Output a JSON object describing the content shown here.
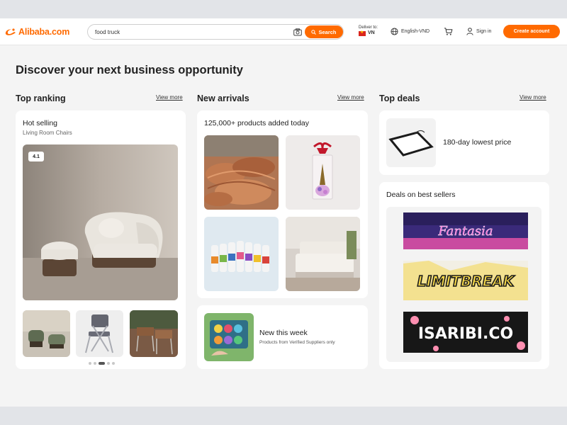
{
  "header": {
    "logo_text": "Alibaba.com",
    "search_value": "food truck",
    "search_button": "Search",
    "deliver_label": "Deliver to:",
    "deliver_country": "VN",
    "language": "English-VND",
    "signin": "Sign in",
    "create_account": "Create account"
  },
  "headline": "Discover your next business opportunity",
  "columns": {
    "top_ranking": {
      "title": "Top ranking",
      "view_more": "View more",
      "card_title": "Hot selling",
      "card_subtitle": "Living Room Chairs",
      "rank_badge": "4.1"
    },
    "new_arrivals": {
      "title": "New arrivals",
      "view_more": "View more",
      "card_title": "125,000+ products added today",
      "week_title": "New this week",
      "week_subtitle": "Products from Verified Suppliers only"
    },
    "top_deals": {
      "title": "Top deals",
      "view_more": "View more",
      "lowest_price": "180-day lowest price",
      "best_sellers": "Deals on best sellers",
      "banner_texts": [
        "Fantasia",
        "LIMITBREAK",
        "ISARIBI.CO"
      ]
    }
  },
  "colors": {
    "accent": "#ff6a00",
    "background": "#f4f4f4",
    "card": "#ffffff"
  },
  "icons": [
    "alibaba-logo-icon",
    "camera-icon",
    "search-icon",
    "globe-icon",
    "cart-icon",
    "user-icon"
  ]
}
